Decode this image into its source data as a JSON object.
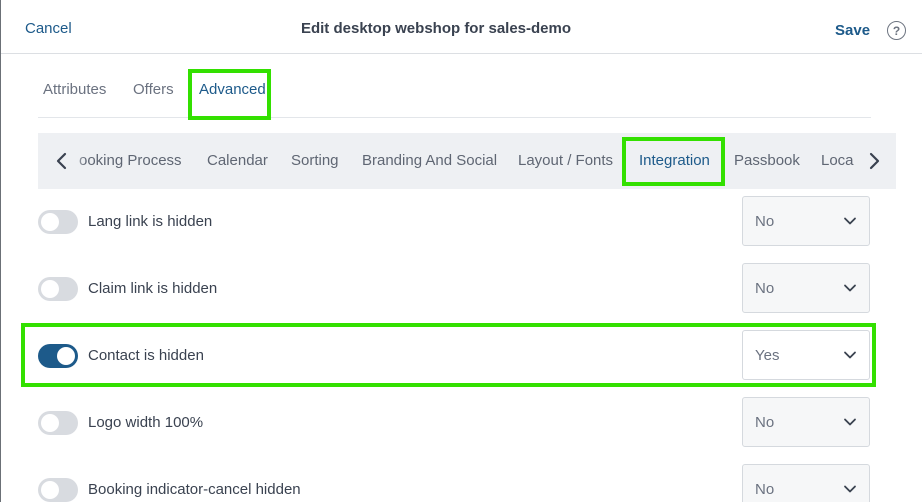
{
  "header": {
    "cancel_label": "Cancel",
    "title": "Edit desktop webshop for sales-demo",
    "save_label": "Save",
    "help_glyph": "?"
  },
  "top_tabs": [
    {
      "label": "Attributes",
      "active": false
    },
    {
      "label": "Offers",
      "active": false
    },
    {
      "label": "Advanced",
      "active": true
    }
  ],
  "sub_tabs": [
    {
      "label": "ooking Process",
      "active": false
    },
    {
      "label": "Calendar",
      "active": false
    },
    {
      "label": "Sorting",
      "active": false
    },
    {
      "label": "Branding And Social",
      "active": false
    },
    {
      "label": "Layout / Fonts",
      "active": false
    },
    {
      "label": "Integration",
      "active": true
    },
    {
      "label": "Passbook",
      "active": false
    },
    {
      "label": "Loca",
      "active": false
    }
  ],
  "settings": [
    {
      "label": "Lang link is hidden",
      "toggle_on": false,
      "value": "No"
    },
    {
      "label": "Claim link is hidden",
      "toggle_on": false,
      "value": "No"
    },
    {
      "label": "Contact is hidden",
      "toggle_on": true,
      "value": "Yes"
    },
    {
      "label": "Logo width 100%",
      "toggle_on": false,
      "value": "No"
    },
    {
      "label": "Booking indicator-cancel hidden",
      "toggle_on": false,
      "value": "No"
    }
  ],
  "colors": {
    "accent": "#1d5a8a",
    "highlight": "#33e000",
    "toggle_off": "#d8dbe0",
    "subbar_bg": "#eef0f3"
  },
  "icons": {
    "help": "help-circle-icon",
    "left_scroll": "chevron-left-icon",
    "right_scroll": "chevron-right-icon",
    "dropdown": "chevron-down-icon"
  }
}
